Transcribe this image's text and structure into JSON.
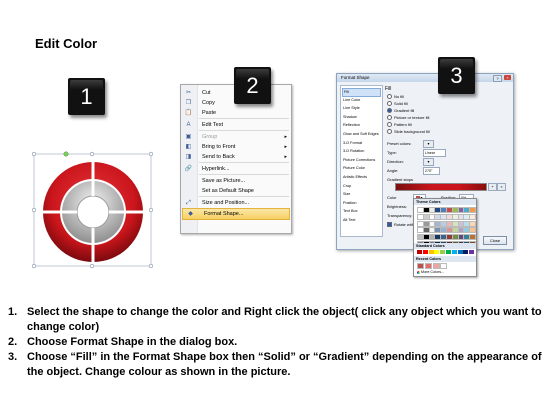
{
  "title": "Edit Color",
  "badges": [
    "1",
    "2",
    "3"
  ],
  "context_menu": {
    "items": [
      {
        "label": "Cut",
        "key": "t",
        "icon": "scissors-icon",
        "glyph": "✂",
        "disabled": false
      },
      {
        "label": "Copy",
        "key": "C",
        "icon": "copy-icon",
        "glyph": "❐",
        "disabled": false
      },
      {
        "label": "Paste",
        "key": "P",
        "icon": "paste-icon",
        "glyph": "📋",
        "disabled": false
      },
      {
        "label": "Edit Text",
        "key": "x",
        "icon": "edit-text-icon",
        "glyph": "A",
        "disabled": false
      },
      {
        "label": "Group",
        "key": "G",
        "icon": "group-icon",
        "glyph": "▣",
        "disabled": true,
        "submenu": true
      },
      {
        "label": "Bring to Front",
        "key": "r",
        "icon": "bring-to-front-icon",
        "glyph": "◧",
        "disabled": false,
        "submenu": true
      },
      {
        "label": "Send to Back",
        "key": "k",
        "icon": "send-to-back-icon",
        "glyph": "◨",
        "disabled": false,
        "submenu": true
      },
      {
        "label": "Hyperlink...",
        "key": "H",
        "icon": "hyperlink-icon",
        "glyph": "🔗",
        "disabled": false
      },
      {
        "label": "Save as Picture...",
        "key": "S",
        "icon": "",
        "glyph": "",
        "disabled": false
      },
      {
        "label": "Set as Default Shape",
        "key": "D",
        "icon": "",
        "glyph": "",
        "disabled": false
      },
      {
        "label": "Size and Position...",
        "key": "z",
        "icon": "size-position-icon",
        "glyph": "⤢",
        "disabled": false
      },
      {
        "label": "Format Shape...",
        "key": "o",
        "icon": "format-shape-icon",
        "glyph": "◆",
        "disabled": false,
        "highlighted": true
      }
    ]
  },
  "format_dialog": {
    "title": "Format Shape",
    "nav_items": [
      "Fill",
      "Line Color",
      "Line Style",
      "Shadow",
      "Reflection",
      "Glow and Soft Edges",
      "3-D Format",
      "3-D Rotation",
      "Picture Corrections",
      "Picture Color",
      "Artistic Effects",
      "Crop",
      "Size",
      "Position",
      "Text Box",
      "Alt Text"
    ],
    "selected_nav": "Fill",
    "section_title": "Fill",
    "fill_options": [
      "No fill",
      "Solid fill",
      "Gradient fill",
      "Picture or texture fill",
      "Pattern fill",
      "Slide background fill"
    ],
    "selected_fill": "Gradient fill",
    "preset_colors_label": "Preset colors:",
    "type_label": "Type:",
    "type_value": "Linear",
    "direction_label": "Direction:",
    "angle_label": "Angle:",
    "angle_value": "270°",
    "gradient_stops_label": "Gradient stops",
    "color_label": "Color",
    "position_label": "Position:",
    "position_value": "0%",
    "brightness_label": "Brightness:",
    "transparency_label": "Transparency:",
    "rotate_label": "Rotate with shape",
    "close_label": "Close"
  },
  "color_picker": {
    "theme_colors_label": "Theme Colors",
    "standard_colors_label": "Standard Colors",
    "recent_colors_label": "Recent Colors",
    "more_colors_label": "More Colors...",
    "theme_row": [
      "#ffffff",
      "#000000",
      "#eeece1",
      "#1f497d",
      "#4f81bd",
      "#c0504d",
      "#9bbb59",
      "#8064a2",
      "#4bacc6",
      "#f79646"
    ],
    "standard_row": [
      "#c00000",
      "#ff0000",
      "#ffc000",
      "#ffff00",
      "#92d050",
      "#00b050",
      "#00b0f0",
      "#0070c0",
      "#002060",
      "#7030a0"
    ],
    "recent_row": [
      "#c0504d",
      "#e46c6a",
      "#f2a3a1",
      "#ffffff"
    ]
  },
  "instructions": [
    {
      "num": "1.",
      "text": "Select the shape to change the color and Right click the object( click any object which you want to change color)"
    },
    {
      "num": "2.",
      "text": "Choose Format Shape in the dialog box."
    },
    {
      "num": "3.",
      "text": "Choose “Fill” in the Format Shape box then “Solid” or “Gradient” depending on the appearance of the object. Change colour as shown in the picture."
    }
  ],
  "colors": {
    "ring_red": "#c9151b",
    "ring_dark": "#7a0a0e",
    "ring_gray": "#b5b5b5",
    "menu_highlight": "#f7cf60",
    "gradient_bar": "#c0504d"
  }
}
